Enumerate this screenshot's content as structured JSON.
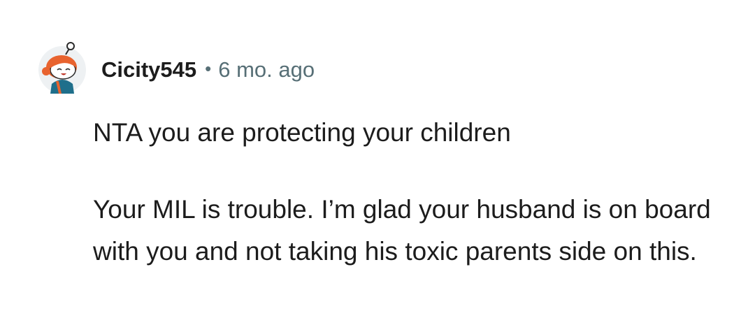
{
  "comment": {
    "avatar": {
      "icon": "snoo-avatar-icon",
      "hair_color": "#e8632f",
      "background": "#eef1f3"
    },
    "author": {
      "username": "Cicity545",
      "separator": "•",
      "timestamp": "6 mo. ago"
    },
    "body": {
      "paragraphs": [
        "NTA you are protecting your children",
        "Your MIL is trouble. I’m glad your husband is on board with you and not taking his toxic parents side on this."
      ]
    }
  }
}
